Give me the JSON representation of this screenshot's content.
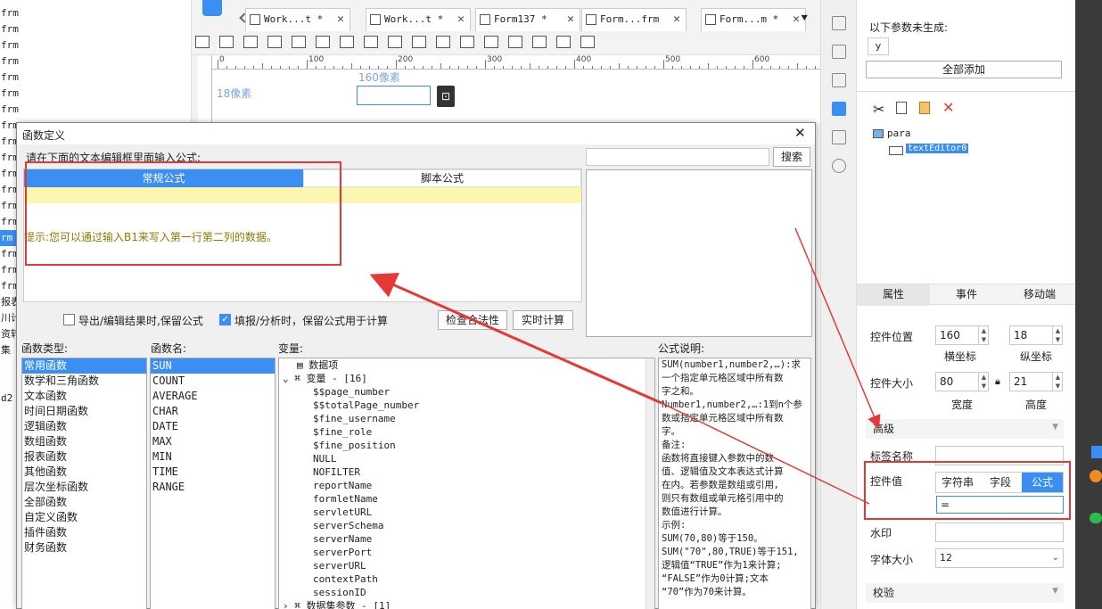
{
  "left_tree": {
    "items": [
      "frm",
      "frm",
      "frm",
      "frm",
      "frm",
      "frm",
      "frm",
      "frm",
      "frm",
      "frm",
      "frm",
      "frm",
      "frm",
      "frm",
      "rm",
      "frm",
      "frm",
      "frm",
      "报表",
      "川计的",
      "资转",
      "集",
      "",
      "",
      "d2"
    ],
    "selected_index": 14
  },
  "tabs": [
    {
      "label": "Work...t *",
      "icon": "grid-icon"
    },
    {
      "label": "Work...t *",
      "icon": "grid-icon"
    },
    {
      "label": "Form137 *",
      "icon": "form-icon"
    },
    {
      "label": "Form...frm",
      "icon": "form-icon"
    },
    {
      "label": "Form...m *",
      "icon": "form-icon"
    }
  ],
  "tab_close": "✕",
  "ruler": {
    "labels": [
      "0",
      "100",
      "200",
      "300",
      "400",
      "500",
      "600"
    ]
  },
  "canvas": {
    "left_label": "18像素",
    "top_label": "160像素"
  },
  "dialog": {
    "title": "函数定义",
    "instruction": "请在下面的文本编辑框里面输入公式:",
    "tab_regular": "常规公式",
    "tab_script": "脚本公式",
    "hint": "提示:您可以通过输入B1来写入第一行第二列的数据。",
    "search_button": "搜索",
    "search_value": "",
    "option_export": "导出/编辑结果时,保留公式",
    "option_export_checked": false,
    "option_fill": "填报/分析时，保留公式用于计算",
    "option_fill_checked": true,
    "check_button": "检查合法性",
    "realtime_button": "实时计算",
    "func_type_label": "函数类型:",
    "func_name_label": "函数名:",
    "var_label": "变量:",
    "desc_label": "公式说明:",
    "func_types": [
      "常用函数",
      "数学和三角函数",
      "文本函数",
      "时间日期函数",
      "逻辑函数",
      "数组函数",
      "报表函数",
      "其他函数",
      "层次坐标函数",
      "全部函数",
      "自定义函数",
      "插件函数",
      "财务函数"
    ],
    "func_names": [
      "SUN",
      "COUNT",
      "AVERAGE",
      "CHAR",
      "DATE",
      "MAX",
      "MIN",
      "TIME",
      "RANGE"
    ],
    "variables": {
      "data_item": "数据项",
      "var_group": "变量 - [16]",
      "var_items": [
        "$$page_number",
        "$$totalPage_number",
        "$fine_username",
        "$fine_role",
        "$fine_position",
        "NULL",
        "NOFILTER",
        "reportName",
        "formletName",
        "servletURL",
        "serverSchema",
        "serverName",
        "serverPort",
        "serverURL",
        "contextPath",
        "sessionID"
      ],
      "dataset_group": "数据集参数 - [1]"
    },
    "description": [
      "SUM(number1,number2,…):求",
      "一个指定单元格区域中所有数",
      "字之和。",
      "Number1,number2,…:1到n个参",
      "数或指定单元格区域中所有数",
      "字。",
      "备注:",
      "函数将直接键入参数中的数",
      "值、逻辑值及文本表达式计算",
      "在内。若参数是数组或引用，",
      "则只有数组或单元格引用中的",
      "数值进行计算。",
      "示例:",
      "SUM(70,80)等于150。",
      "SUM(\"70\",80,TRUE)等于151,",
      "逻辑值“TRUE”作为1来计算;",
      "“FALSE”作为0计算;文本",
      "“70”作为70来计算。"
    ]
  },
  "right_panel": {
    "ungenerated_label": "以下参数未生成:",
    "param_chip": "y",
    "add_all_button": "全部添加",
    "tree_root": "para",
    "tree_child": "textEditor0",
    "tabs": [
      "属性",
      "事件",
      "移动端"
    ],
    "pos_label": "控件位置",
    "x_value": "160",
    "y_value": "18",
    "x_caption": "横坐标",
    "y_caption": "纵坐标",
    "size_label": "控件大小",
    "w_value": "80",
    "h_value": "21",
    "w_caption": "宽度",
    "h_caption": "高度",
    "advanced_label": "高级",
    "tagname_label": "标签名称",
    "tagname_value": "",
    "value_label": "控件值",
    "value_modes": [
      "字符串",
      "字段",
      "公式"
    ],
    "value_mode_selected": 2,
    "formula_value": "=",
    "watermark_label": "水印",
    "watermark_value": "",
    "fontsize_label": "字体大小",
    "fontsize_value": "12",
    "validate_label": "校验"
  },
  "colors": {
    "accent": "#3b8ff3",
    "red": "#e53935",
    "hint": "#8a7a00",
    "editor_line": "#fdf6b0"
  }
}
